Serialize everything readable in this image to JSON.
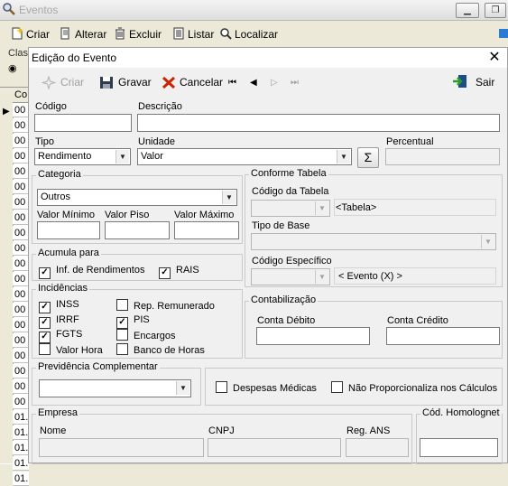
{
  "bg": {
    "title": "Eventos",
    "toolbar": {
      "criar": "Criar",
      "alterar": "Alterar",
      "excluir": "Excluir",
      "listar": "Listar",
      "localizar": "Localizar"
    },
    "class_label": "Clas",
    "grid_header": "Co",
    "row_prefix_a": "00",
    "row_prefix_b": "01."
  },
  "dialog": {
    "title": "Edição do Evento",
    "toolbar": {
      "criar": "Criar",
      "gravar": "Gravar",
      "cancelar": "Cancelar",
      "sair": "Sair"
    },
    "codigo": {
      "label": "Código",
      "value": ""
    },
    "descricao": {
      "label": "Descrição",
      "value": ""
    },
    "tipo": {
      "label": "Tipo",
      "value": "Rendimento"
    },
    "unidade": {
      "label": "Unidade",
      "value": "Valor"
    },
    "percentual": {
      "label": "Percentual",
      "value": ""
    },
    "categoria": {
      "group": "Categoria",
      "value": "Outros",
      "valor_minimo": "Valor Mínimo",
      "valor_piso": "Valor Piso",
      "valor_maximo": "Valor Máximo"
    },
    "conforme_tabela": {
      "group": "Conforme Tabela",
      "codigo_tabela": "Código da Tabela",
      "tabela_text": "<Tabela>",
      "tipo_base": "Tipo de Base",
      "codigo_especifico": "Código Específico",
      "evento_text": "< Evento (X) >"
    },
    "acumula": {
      "group": "Acumula para",
      "inf_rend": "Inf. de Rendimentos",
      "rais": "RAIS"
    },
    "incidencias": {
      "group": "Incidências",
      "inss": "INSS",
      "irrf": "IRRF",
      "fgts": "FGTS",
      "valor_hora": "Valor Hora",
      "rep_remunerado": "Rep. Remunerado",
      "pis": "PIS",
      "encargos": "Encargos",
      "banco_horas": "Banco de Horas"
    },
    "contabilizacao": {
      "group": "Contabilização",
      "conta_debito": "Conta Débito",
      "conta_credito": "Conta Crédito"
    },
    "previdencia": {
      "group": "Previdência Complementar",
      "value": ""
    },
    "despesas_medicas": "Despesas Médicas",
    "nao_proporcionaliza": "Não Proporcionaliza nos Cálculos",
    "empresa": {
      "group": "Empresa",
      "nome": "Nome",
      "cnpj": "CNPJ",
      "reg_ans": "Reg. ANS"
    },
    "cod_homolognet": {
      "group": "Cód. Homolognet"
    }
  },
  "colors": {
    "accent": "#cc2200",
    "window_bg": "#f0f0f0",
    "disabled_text": "#a0a0a0"
  }
}
